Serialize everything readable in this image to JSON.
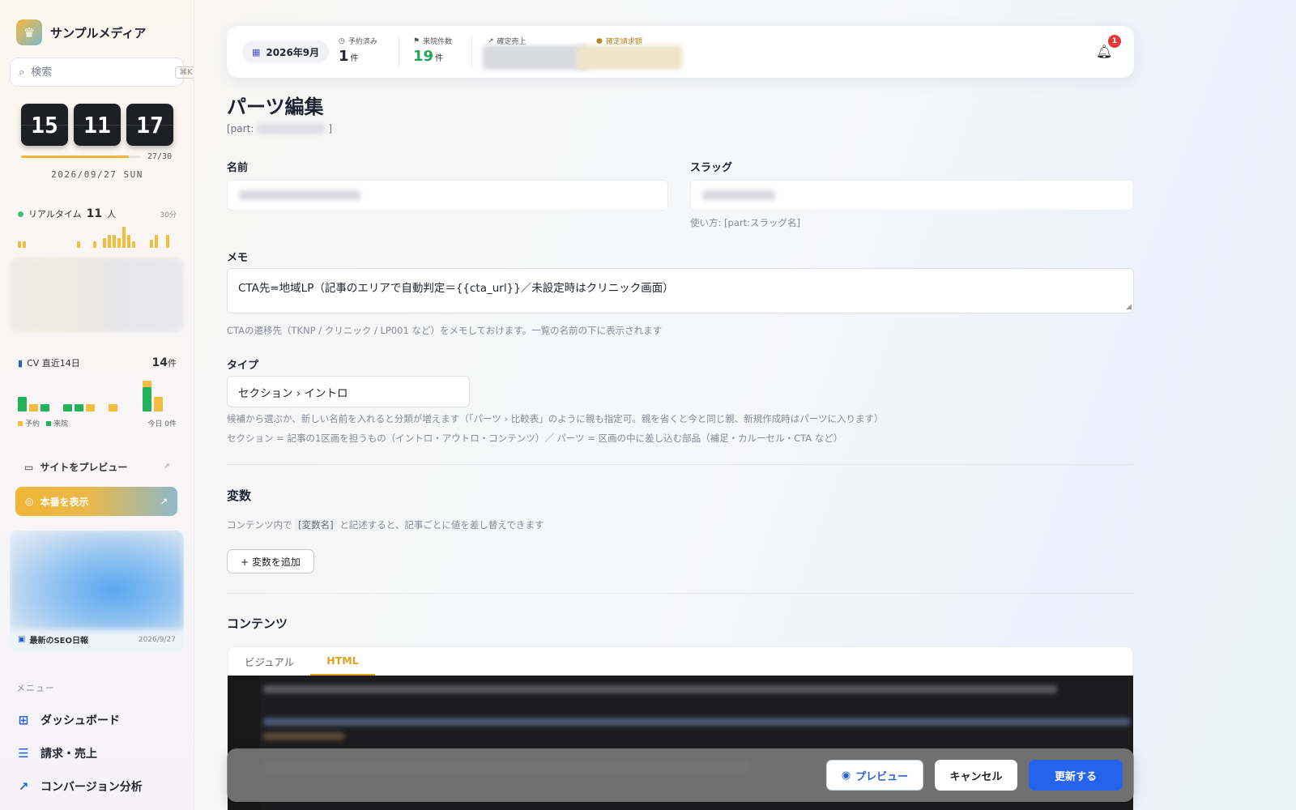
{
  "sidebar": {
    "brand": "サンプルメディア",
    "search": {
      "placeholder": "検索",
      "shortcut": "⌘K"
    },
    "clock": {
      "hh": "15",
      "mm": "11",
      "ss": "17",
      "progress_label": "27/30",
      "progress_fraction": 0.9,
      "date": "2026/09/27 SUN"
    },
    "realtime": {
      "label": "リアルタイム",
      "count": "11",
      "unit": "人",
      "range": "30分"
    },
    "cv": {
      "label": "CV 直近14日",
      "total": "14",
      "unit": "件",
      "legend_booked": "予約",
      "legend_visited": "来院",
      "today": "今日 0件"
    },
    "site_preview": "サイトをプレビュー",
    "production": "本番を表示",
    "seo": {
      "title": "最新のSEO日報",
      "date": "2026/9/27"
    },
    "menu_title": "メニュー",
    "menu": [
      {
        "label": "ダッシュボード",
        "icon": "grid-icon"
      },
      {
        "label": "請求・売上",
        "icon": "receipt-icon"
      },
      {
        "label": "コンバージョン分析",
        "icon": "chart-line-icon"
      }
    ]
  },
  "topbar": {
    "month": "2026年9月",
    "booked": {
      "label": "予約済み",
      "value": "1",
      "unit": "件"
    },
    "visited": {
      "label": "来院件数",
      "value": "19",
      "unit": "件"
    },
    "sales": {
      "label": "確定売上"
    },
    "invoice": {
      "label": "確定請求額"
    },
    "notifications": "1"
  },
  "main": {
    "title": "パーツ編集",
    "part_prefix": "[part:",
    "part_suffix": "]",
    "name_label": "名前",
    "slug_label": "スラッグ",
    "slug_help": "使い方: [part:スラッグ名]",
    "memo_label": "メモ",
    "memo_value": "CTA先=地域LP（記事のエリアで自動判定＝{{cta_url}}／未設定時はクリニック画面）",
    "memo_help": "CTAの遷移先（TKNP / クリニック / LP001 など）をメモしておけます。一覧の名前の下に表示されます",
    "type_label": "タイプ",
    "type_value": "セクション › イントロ",
    "type_help1": "候補から選ぶか、新しい名前を入れると分類が増えます（「パーツ › 比較表」のように親も指定可。親を省くと今と同じ親、新規作成時はパーツに入ります）",
    "type_help2": "セクション = 記事の1区画を担うもの（イントロ・アウトロ・コンテンツ）／ パーツ = 区画の中に差し込む部品（補足・カルーセル・CTA など）",
    "vars_title": "変数",
    "vars_help_pre": "コンテンツ内で",
    "vars_help_tag": "[変数名]",
    "vars_help_post": "と記述すると、記事ごとに値を差し替えできます",
    "add_var": "+ 変数を追加",
    "content_title": "コンテンツ",
    "tab_visual": "ビジュアル",
    "tab_html": "HTML"
  },
  "actions": {
    "preview": "プレビュー",
    "cancel": "キャンセル",
    "update": "更新する"
  },
  "colors": {
    "accent_blue": "#2563eb",
    "accent_gold": "#f2b536",
    "green": "#22b35a"
  }
}
